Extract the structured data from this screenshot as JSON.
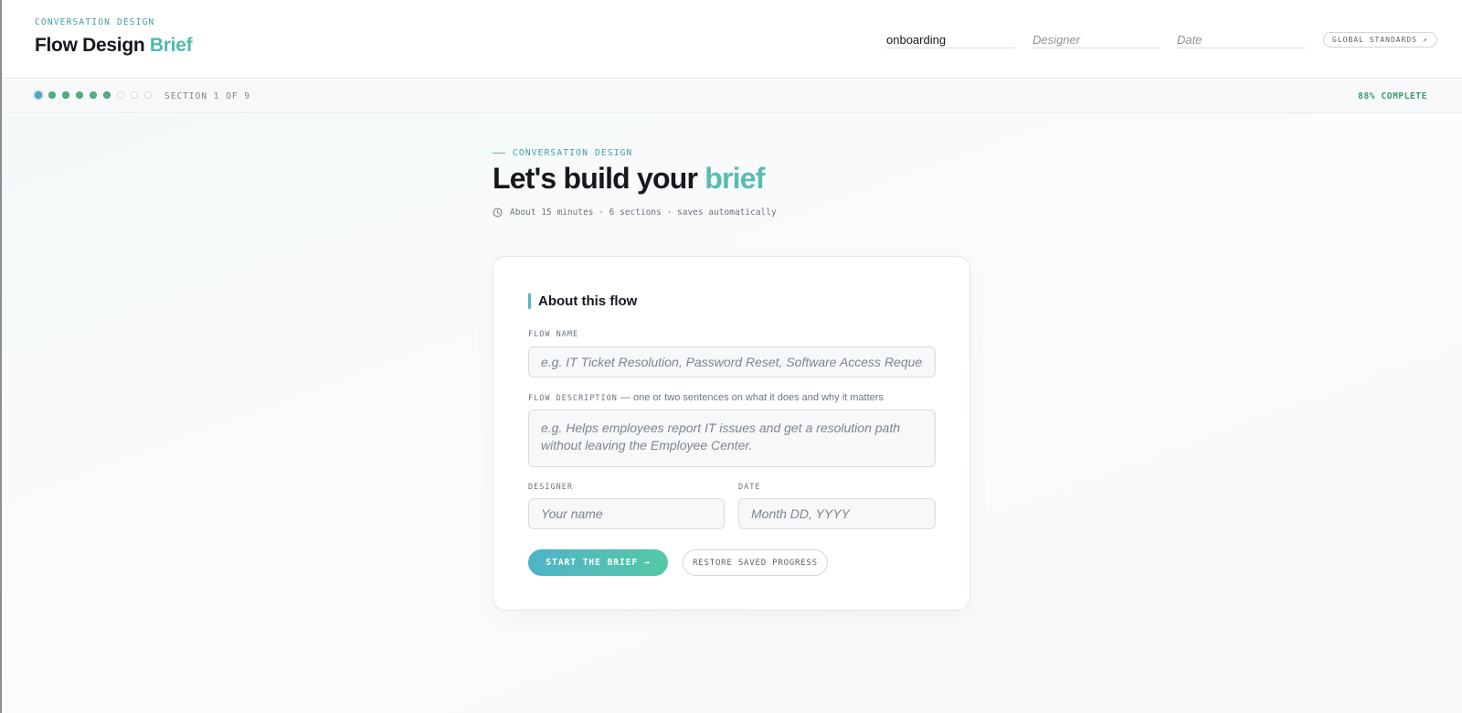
{
  "header": {
    "eyebrow": "CONVERSATION DESIGN",
    "title_main": "Flow Design",
    "title_accent": "Brief",
    "flow_field": {
      "value": "onboarding",
      "placeholder": ""
    },
    "designer_field": {
      "value": "",
      "placeholder": "Designer"
    },
    "date_field": {
      "value": "",
      "placeholder": "Date"
    },
    "standards_button": "GLOBAL STANDARDS ↗"
  },
  "progress": {
    "dots": [
      "current",
      "done",
      "done",
      "done",
      "done",
      "done",
      "todo",
      "todo",
      "todo"
    ],
    "section_label": "SECTION 1 OF 9",
    "complete_label": "88% COMPLETE",
    "complete_fraction": 0.88
  },
  "hero": {
    "eyebrow": "CONVERSATION DESIGN",
    "title_main": "Let's build your",
    "title_accent": "brief",
    "meta": "About 15 minutes · 6 sections · saves automatically"
  },
  "card": {
    "title": "About this flow",
    "flow_name": {
      "label": "FLOW NAME",
      "value": "",
      "placeholder": "e.g. IT Ticket Resolution, Password Reset, Software Access Request"
    },
    "flow_description": {
      "label": "FLOW DESCRIPTION",
      "hint": " — one or two sentences on what it does and why it matters",
      "value": "",
      "placeholder": "e.g. Helps employees report IT issues and get a resolution path without leaving the Employee Center."
    },
    "designer": {
      "label": "DESIGNER",
      "value": "",
      "placeholder": "Your name"
    },
    "date": {
      "label": "DATE",
      "value": "",
      "placeholder": "Month DD, YYYY"
    },
    "start_button": "START THE BRIEF →",
    "restore_button": "RESTORE SAVED PROGRESS"
  },
  "colors": {
    "accent": "#58bcb3",
    "eyebrow": "#3f9ea8",
    "progress_done": "#4db382",
    "progress_current": "#5aa8c9",
    "complete_text": "#3a9b6c"
  }
}
